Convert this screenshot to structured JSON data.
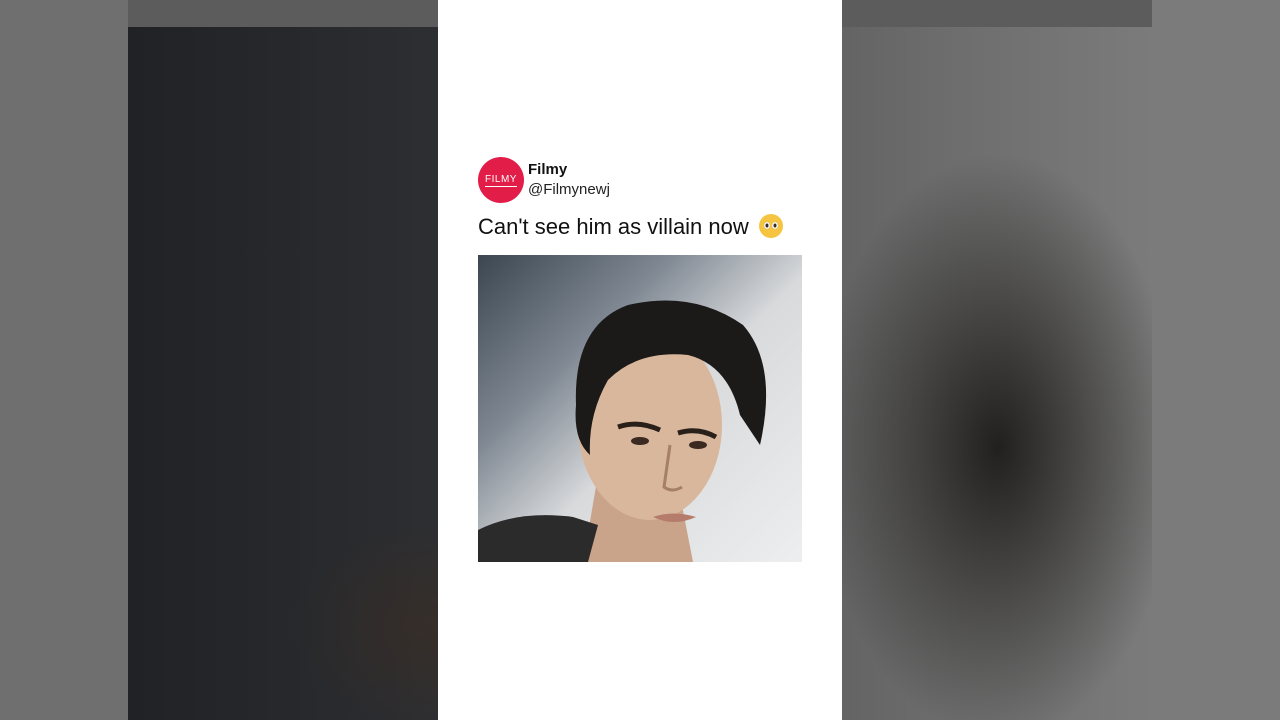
{
  "post": {
    "avatar_text": "FILMY",
    "display_name": "Filmy",
    "handle": "@Filmynewj",
    "text": "Can't see him as villain now",
    "emoji": "pleading-face-icon"
  },
  "colors": {
    "avatar_bg": "#e11d48",
    "card_bg": "#ffffff"
  }
}
